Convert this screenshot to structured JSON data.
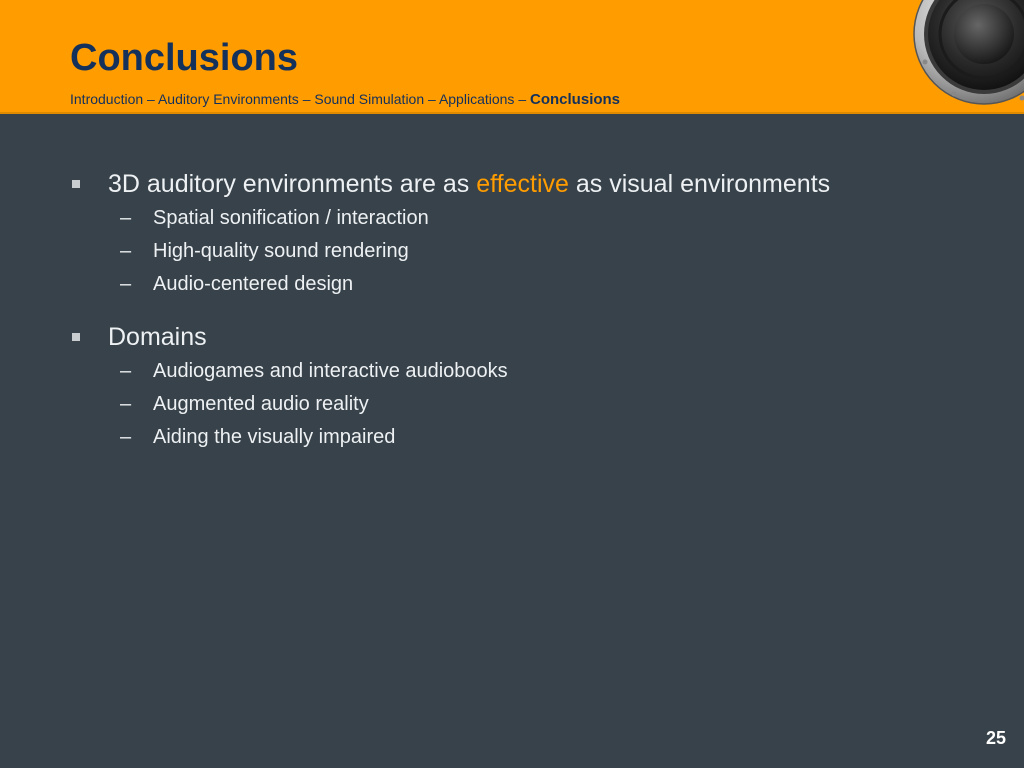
{
  "slide": {
    "title": "Conclusions",
    "breadcrumb": {
      "items": [
        "Introduction",
        "Auditory Environments",
        "Sound Simulation",
        "Applications"
      ],
      "separator": " – ",
      "current": "Conclusions"
    },
    "page_number": "25",
    "colors": {
      "header": "#ff9c00",
      "title": "#14315c",
      "background": "#37424a",
      "accent": "#ff9c00",
      "text": "#eef1f3"
    },
    "decoration_icon": "speaker-icon"
  },
  "bullets": [
    {
      "text_before": "3D auditory environments are as ",
      "highlight": "effective",
      "text_after": " as visual environments",
      "subitems": [
        "Spatial sonification / interaction",
        "High-quality sound rendering",
        "Audio-centered design"
      ]
    },
    {
      "text": "Domains",
      "subitems": [
        "Audiogames and interactive audiobooks",
        "Augmented audio reality",
        "Aiding the visually impaired"
      ]
    }
  ]
}
